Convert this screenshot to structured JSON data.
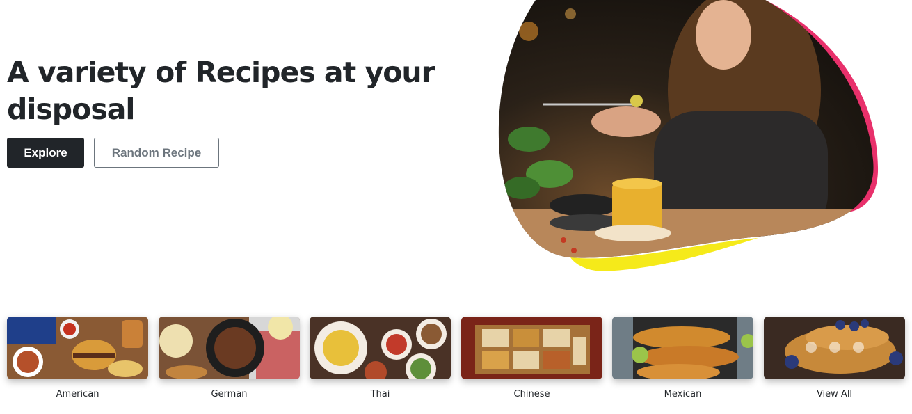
{
  "hero": {
    "title": "A variety of Recipes at your disposal",
    "explore_label": "Explore",
    "random_label": "Random Recipe"
  },
  "categories": [
    {
      "label": "American"
    },
    {
      "label": "German"
    },
    {
      "label": "Thai"
    },
    {
      "label": "Chinese"
    },
    {
      "label": "Mexican"
    },
    {
      "label": "View All"
    }
  ],
  "colors": {
    "dark": "#212529",
    "muted": "#6c757d",
    "blob_accent_pink": "#e8306b",
    "blob_accent_yellow": "#f5ea1a"
  }
}
